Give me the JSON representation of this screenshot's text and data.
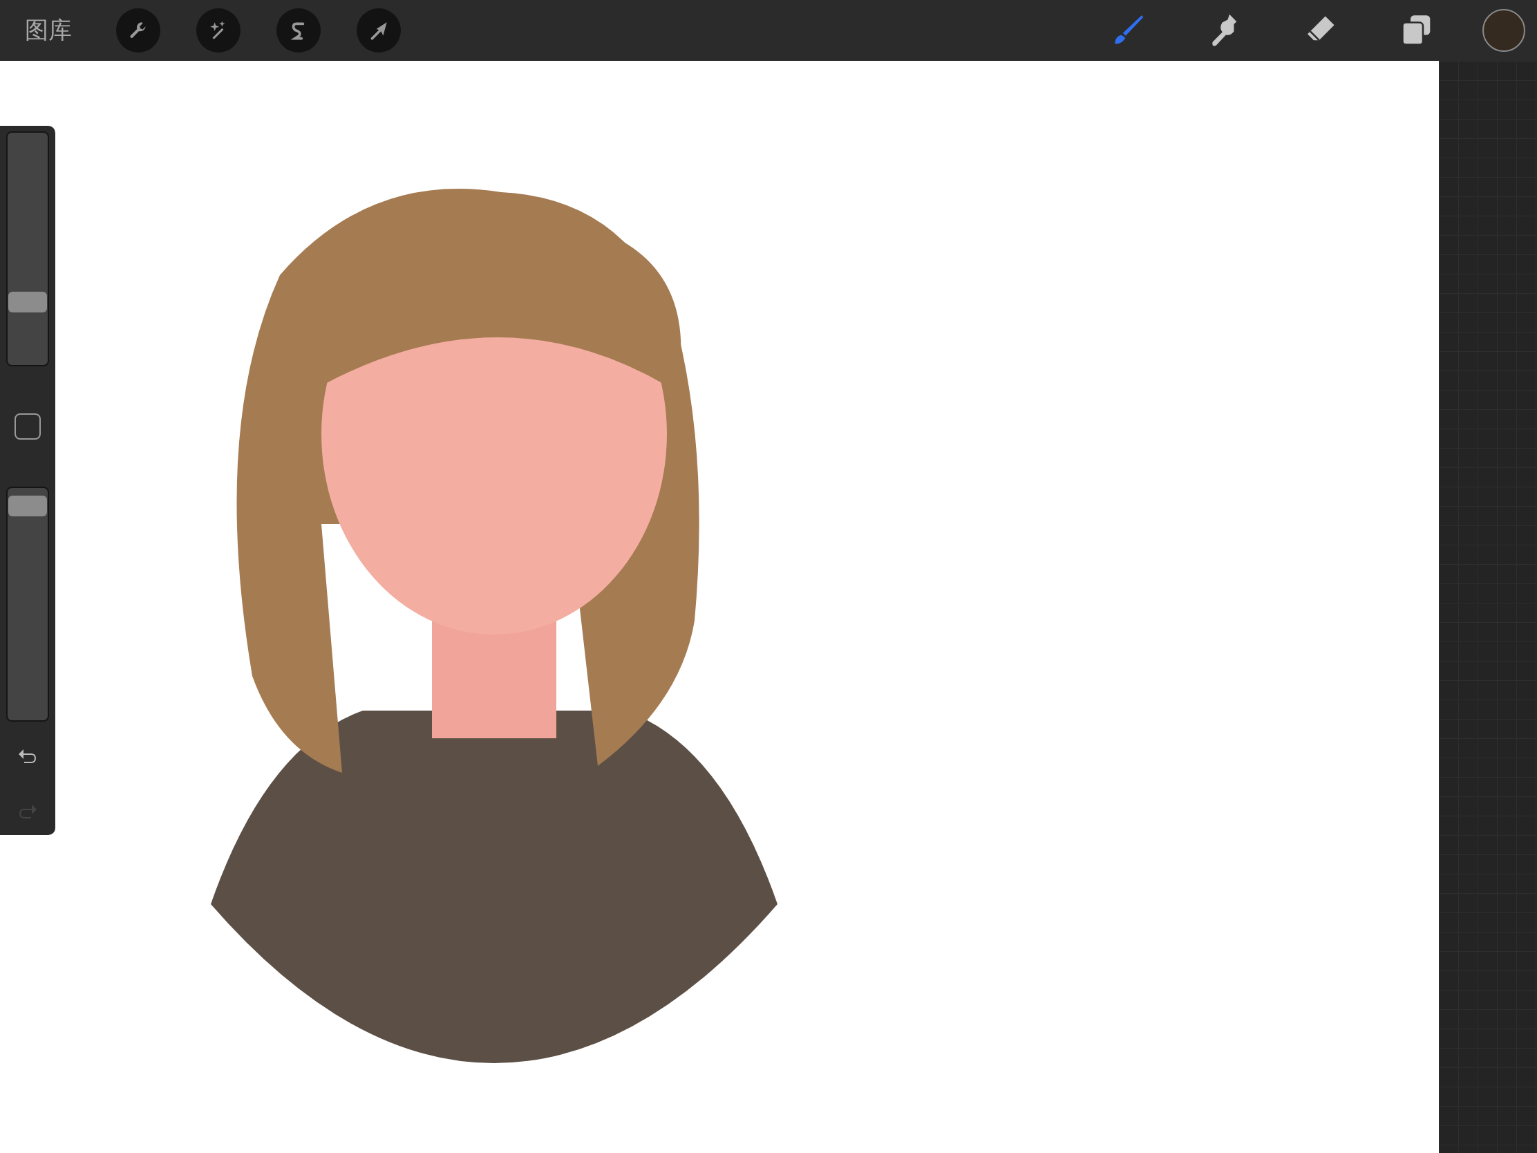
{
  "toolbar": {
    "gallery_label": "图库",
    "left_tools": [
      {
        "kind": "wrench"
      },
      {
        "kind": "wand"
      },
      {
        "kind": "selection"
      },
      {
        "kind": "move"
      }
    ],
    "right_tools": [
      {
        "kind": "brush",
        "selected": true
      },
      {
        "kind": "smudge",
        "selected": false
      },
      {
        "kind": "eraser",
        "selected": false
      },
      {
        "kind": "layers",
        "selected": false
      }
    ],
    "color_swatch": {
      "color": "#342a20"
    }
  },
  "sidebar": {
    "sliders": [
      {
        "level": 0.25
      },
      {
        "level": 0.97
      }
    ],
    "undo": {
      "disabled": false
    },
    "redo": {
      "disabled": true
    }
  }
}
